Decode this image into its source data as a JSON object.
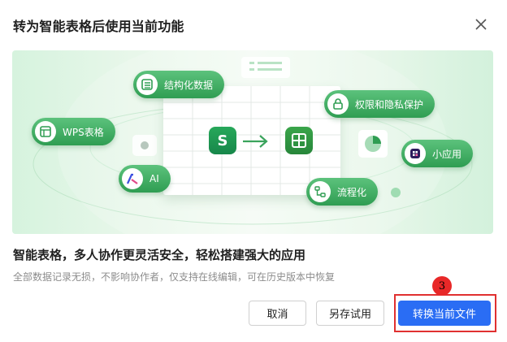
{
  "dialog": {
    "title": "转为智能表格后使用当前功能",
    "close_icon": "close-icon"
  },
  "illustration": {
    "features": [
      {
        "label": "结构化数据",
        "icon": "table-list-icon"
      },
      {
        "label": "WPS表格",
        "icon": "spreadsheet-icon"
      },
      {
        "label": "AI",
        "icon": "ai-icon"
      },
      {
        "label": "权限和隐私保护",
        "icon": "lock-icon"
      },
      {
        "label": "小应用",
        "icon": "app-grid-icon"
      },
      {
        "label": "流程化",
        "icon": "flow-icon"
      }
    ],
    "source_badge": "S",
    "colors": {
      "pill": "#3faa5e",
      "source": "#1f9a4f",
      "target": "#2e8f3d"
    }
  },
  "content": {
    "headline": "智能表格，多人协作更灵活安全，轻松搭建强大的应用",
    "subline": "全部数据记录无损，不影响协作者，仅支持在线编辑，可在历史版本中恢复"
  },
  "buttons": {
    "cancel": "取消",
    "save_as": "另存试用",
    "convert": "转换当前文件"
  },
  "annotation": {
    "step": "3",
    "color": "#e03030"
  },
  "colors": {
    "primary": "#2a6df4",
    "accent_green": "#3faa5e"
  }
}
